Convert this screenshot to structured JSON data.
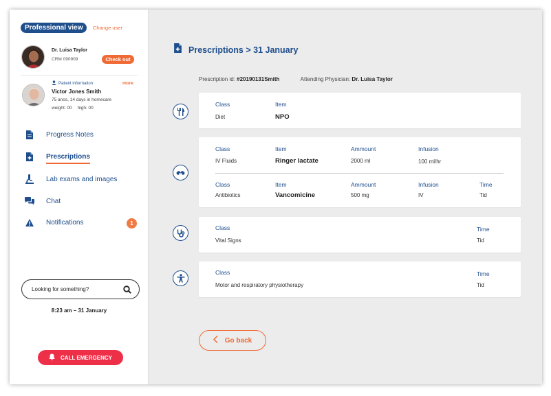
{
  "sidebar": {
    "view_label": "Professional view",
    "change_user": "Change user",
    "doctor": {
      "name": "Dr. Luisa Taylor",
      "crm": "CRM 090909",
      "checkout_label": "Check out"
    },
    "patient": {
      "section_label": "Patient information",
      "more_label": "more",
      "name": "Victor Jones Smith",
      "line1": "75 anos, 14 days in homecare",
      "weight": "weight: 00",
      "height": "high: 00"
    },
    "nav": [
      {
        "label": "Progress Notes",
        "icon": "document-icon"
      },
      {
        "label": "Prescriptions",
        "icon": "prescription-icon"
      },
      {
        "label": "Lab exams and images",
        "icon": "microscope-icon"
      },
      {
        "label": "Chat",
        "icon": "chat-icon"
      },
      {
        "label": "Notifications",
        "icon": "warning-icon",
        "badge": "1"
      }
    ],
    "search_placeholder": "Looking for something?",
    "datetime": "8:23 am – 31 January",
    "emergency_label": "CALL EMERGENCY"
  },
  "main": {
    "title": "Prescriptions > 31 January",
    "prescription_id_label": "Prescription id:",
    "prescription_id": "#20190131Smith",
    "physician_label": "Attending Physician:",
    "physician": "Dr. Luisa Taylor",
    "cards": [
      {
        "icon": "utensils-icon",
        "headers": {
          "class": "Class",
          "item": "Item"
        },
        "values": {
          "class": "Diet",
          "item": "NPO"
        }
      },
      {
        "icon": "capsules-icon",
        "rows": [
          {
            "headers": {
              "class": "Class",
              "item": "Item",
              "amount": "Ammount",
              "infusion": "Infusion"
            },
            "values": {
              "class": "IV Fluids",
              "item": "Ringer lactate",
              "amount": "2000 ml",
              "infusion": "100 ml/hr"
            }
          },
          {
            "headers": {
              "class": "Class",
              "item": "Item",
              "amount": "Ammount",
              "infusion": "Infusion",
              "time": "Time"
            },
            "values": {
              "class": "Antibiotics",
              "item": "Vancomicine",
              "amount": "500 mg",
              "infusion": "IV",
              "time": "Tid"
            }
          }
        ]
      },
      {
        "icon": "stethoscope-icon",
        "headers": {
          "class": "Class",
          "time": "Time"
        },
        "values": {
          "class": "Vital Signs",
          "time": "Tid"
        }
      },
      {
        "icon": "accessibility-icon",
        "headers": {
          "class": "Class",
          "time": "Time"
        },
        "values": {
          "class": "Motor and respiratory physiotherapy",
          "time": "Tid"
        }
      }
    ],
    "go_back_label": "Go back"
  },
  "colors": {
    "primary": "#1f4e8c",
    "accent": "#f06a35",
    "emergency": "#ee2f48",
    "background": "#ececec"
  }
}
